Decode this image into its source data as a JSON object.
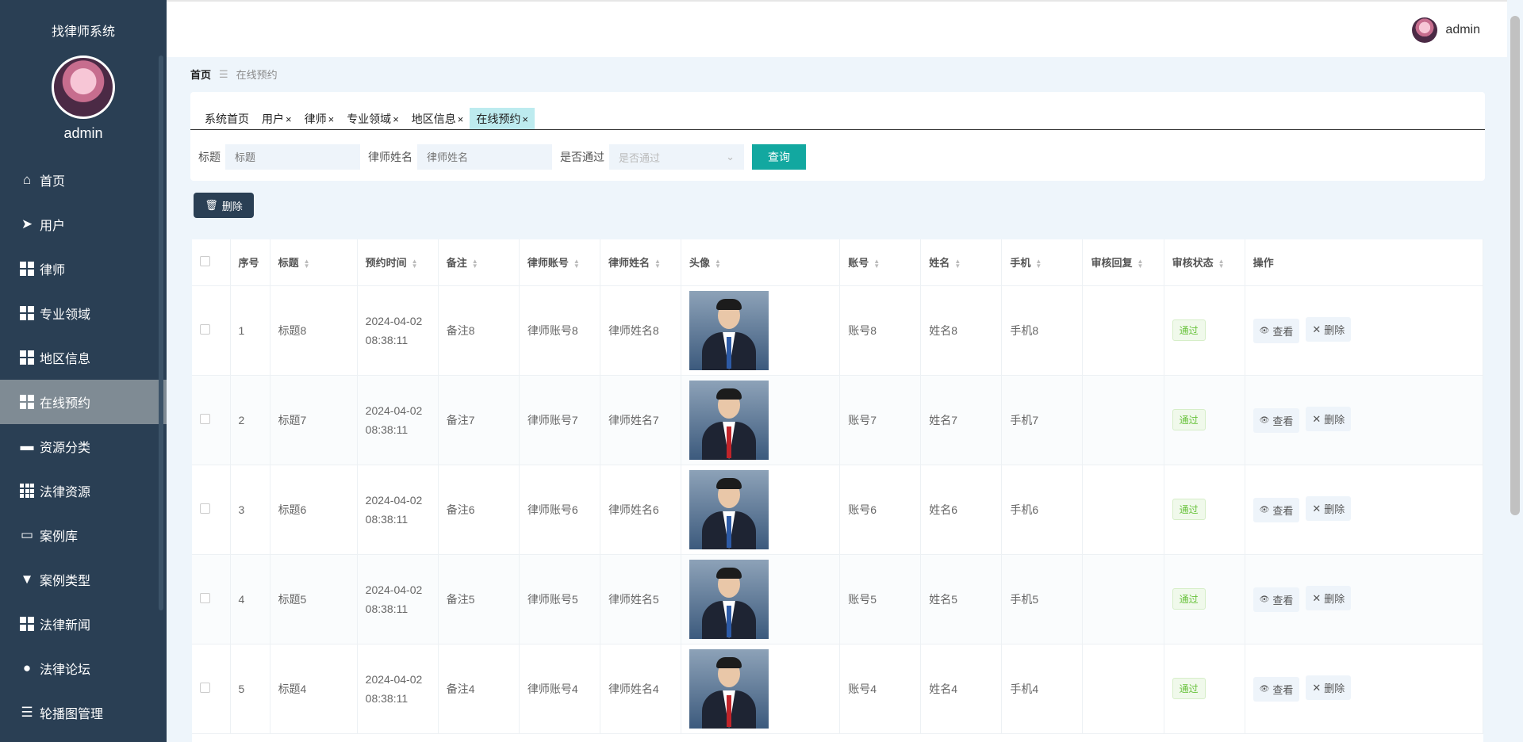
{
  "app": {
    "title": "找律师系统",
    "username": "admin"
  },
  "sidebar": {
    "items": [
      {
        "label": "首页",
        "icon": "home-icon"
      },
      {
        "label": "用户",
        "icon": "paper-plane-icon"
      },
      {
        "label": "律师",
        "icon": "grid-icon"
      },
      {
        "label": "专业领域",
        "icon": "grid-icon"
      },
      {
        "label": "地区信息",
        "icon": "grid-icon"
      },
      {
        "label": "在线预约",
        "icon": "grid-icon",
        "active": true
      },
      {
        "label": "资源分类",
        "icon": "wallet-icon"
      },
      {
        "label": "法律资源",
        "icon": "grid9-icon"
      },
      {
        "label": "案例库",
        "icon": "monitor-icon"
      },
      {
        "label": "案例类型",
        "icon": "brush-icon"
      },
      {
        "label": "法律新闻",
        "icon": "grid-icon"
      },
      {
        "label": "法律论坛",
        "icon": "user-icon"
      },
      {
        "label": "轮播图管理",
        "icon": "list-icon"
      }
    ]
  },
  "header": {
    "username": "admin"
  },
  "breadcrumb": {
    "home": "首页",
    "separator": "☰",
    "current": "在线预约"
  },
  "tabs": [
    {
      "label": "系统首页",
      "closable": false
    },
    {
      "label": "用户",
      "closable": true
    },
    {
      "label": "律师",
      "closable": true
    },
    {
      "label": "专业领域",
      "closable": true
    },
    {
      "label": "地区信息",
      "closable": true
    },
    {
      "label": "在线预约",
      "closable": true,
      "active": true
    }
  ],
  "search": {
    "title_label": "标题",
    "title_placeholder": "标题",
    "lawyer_label": "律师姓名",
    "lawyer_placeholder": "律师姓名",
    "approved_label": "是否通过",
    "approved_placeholder": "是否通过",
    "query_button": "查询"
  },
  "toolbar": {
    "delete_label": "删除"
  },
  "table": {
    "columns": [
      "序号",
      "标题",
      "预约时间",
      "备注",
      "律师账号",
      "律师姓名",
      "头像",
      "账号",
      "姓名",
      "手机",
      "审核回复",
      "审核状态",
      "操作"
    ],
    "rows": [
      {
        "index": "1",
        "title": "标题8",
        "date": "2024-04-02",
        "time": "08:38:11",
        "note": "备注8",
        "lawyer_account": "律师账号8",
        "lawyer_name": "律师姓名8",
        "account": "账号8",
        "name": "姓名8",
        "phone": "手机8",
        "reply": "",
        "status": "通过",
        "tie": "#2d5aa6"
      },
      {
        "index": "2",
        "title": "标题7",
        "date": "2024-04-02",
        "time": "08:38:11",
        "note": "备注7",
        "lawyer_account": "律师账号7",
        "lawyer_name": "律师姓名7",
        "account": "账号7",
        "name": "姓名7",
        "phone": "手机7",
        "reply": "",
        "status": "通过",
        "tie": "#c0242a"
      },
      {
        "index": "3",
        "title": "标题6",
        "date": "2024-04-02",
        "time": "08:38:11",
        "note": "备注6",
        "lawyer_account": "律师账号6",
        "lawyer_name": "律师姓名6",
        "account": "账号6",
        "name": "姓名6",
        "phone": "手机6",
        "reply": "",
        "status": "通过",
        "tie": "#2d5aa6"
      },
      {
        "index": "4",
        "title": "标题5",
        "date": "2024-04-02",
        "time": "08:38:11",
        "note": "备注5",
        "lawyer_account": "律师账号5",
        "lawyer_name": "律师姓名5",
        "account": "账号5",
        "name": "姓名5",
        "phone": "手机5",
        "reply": "",
        "status": "通过",
        "tie": "#2d5aa6"
      },
      {
        "index": "5",
        "title": "标题4",
        "date": "2024-04-02",
        "time": "08:38:11",
        "note": "备注4",
        "lawyer_account": "律师账号4",
        "lawyer_name": "律师姓名4",
        "account": "账号4",
        "name": "姓名4",
        "phone": "手机4",
        "reply": "",
        "status": "通过",
        "tie": "#c0242a"
      }
    ],
    "view_label": "查看",
    "delete_label": "删除"
  },
  "colors": {
    "sidebar_bg": "#2a3f54",
    "accent": "#12a8a0",
    "active_tab": "#bdebef",
    "status_green": "#67c23a"
  }
}
